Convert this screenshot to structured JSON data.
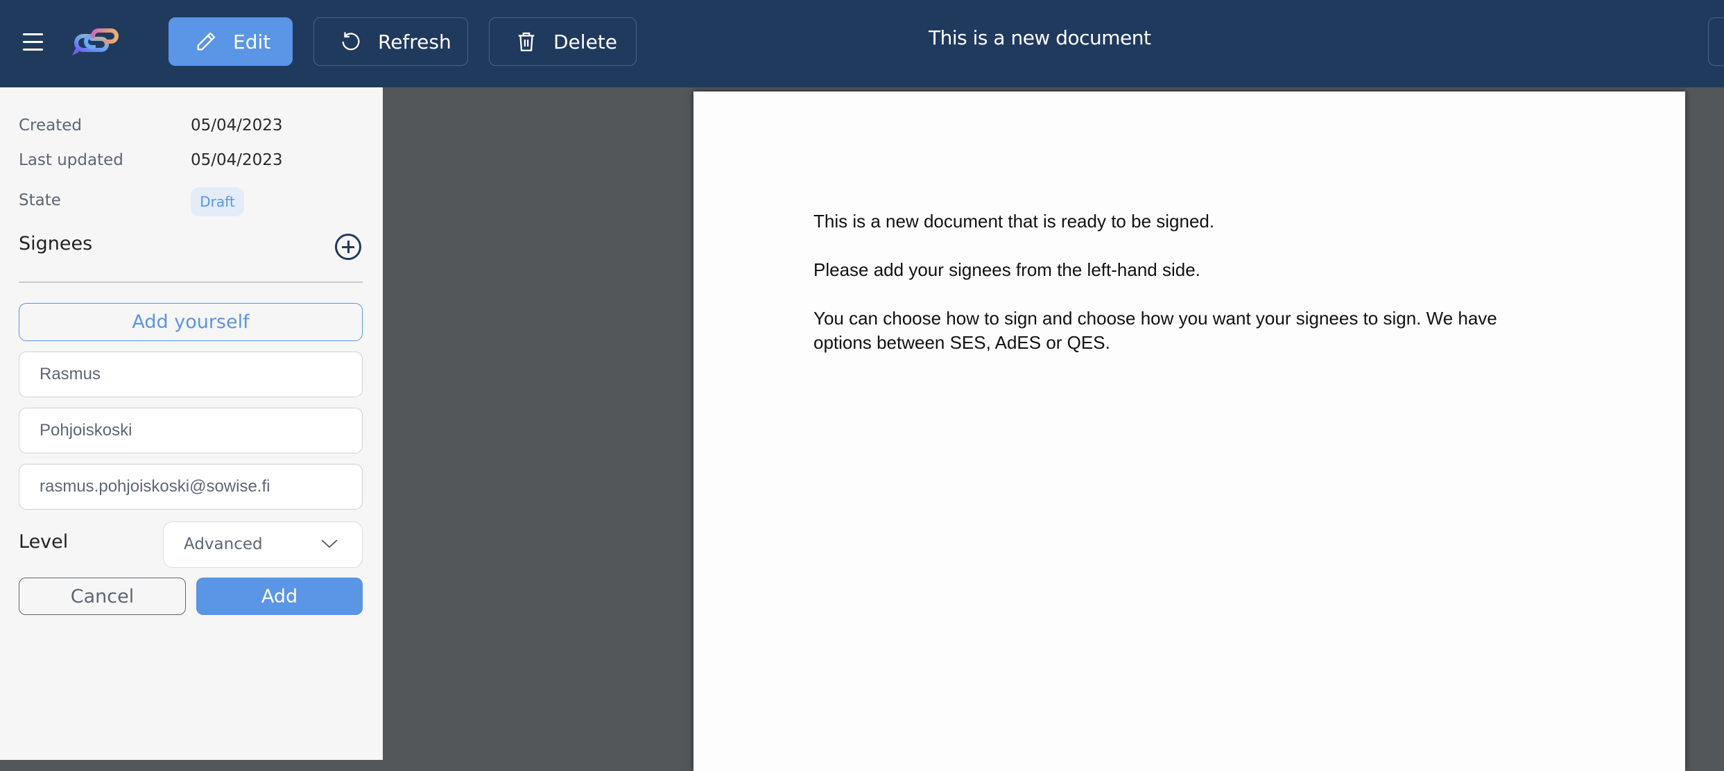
{
  "header": {
    "menu_icon": "hamburger-menu-icon",
    "logo_icon": "chat-link-logo-icon",
    "buttons": {
      "edit": {
        "label": "Edit",
        "icon": "pencil-icon"
      },
      "refresh": {
        "label": "Refresh",
        "icon": "refresh-icon"
      },
      "delete": {
        "label": "Delete",
        "icon": "trash-icon"
      }
    },
    "title": "This is a new document"
  },
  "sidebar": {
    "meta": {
      "created_label": "Created",
      "created_value": "05/04/2023",
      "updated_label": "Last updated",
      "updated_value": "05/04/2023",
      "state_label": "State",
      "state_value": "Draft"
    },
    "signees": {
      "heading": "Signees",
      "add_icon": "plus-circle-icon",
      "add_yourself_label": "Add yourself",
      "first_name_value": "Rasmus",
      "last_name_value": "Pohjoiskoski",
      "email_value": "rasmus.pohjoiskoski@sowise.fi",
      "level_label": "Level",
      "level_selected": "Advanced",
      "cancel_label": "Cancel",
      "add_label": "Add"
    }
  },
  "document": {
    "paragraphs": [
      "This is a new document that is ready to be signed.",
      "Please add your signees from the left-hand side.",
      "You can choose how to sign and choose how you want your signees to sign. We have",
      "options between SES, AdES or QES."
    ]
  },
  "colors": {
    "header_bg": "#203a5e",
    "accent": "#5a95e6",
    "sidebar_bg": "#f6f6f6",
    "viewer_bg": "#53575a"
  }
}
